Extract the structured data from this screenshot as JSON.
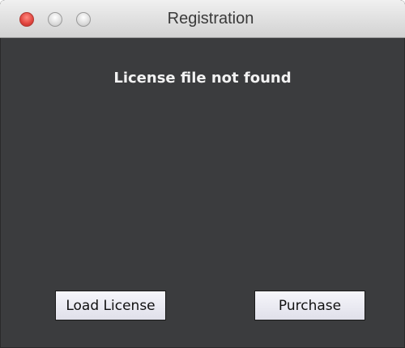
{
  "window": {
    "title": "Registration",
    "message": "License file not found"
  },
  "buttons": {
    "load_label": "Load License",
    "purchase_label": "Purchase"
  },
  "colors": {
    "background": "#3b3c3e",
    "titlebar": "#d8d8d8",
    "close": "#e0443e",
    "text": "#f2f2f2",
    "button": "#ececf4"
  },
  "icons": {
    "close": "close-button-icon",
    "minimize": "minimize-button-icon",
    "zoom": "zoom-button-icon"
  }
}
